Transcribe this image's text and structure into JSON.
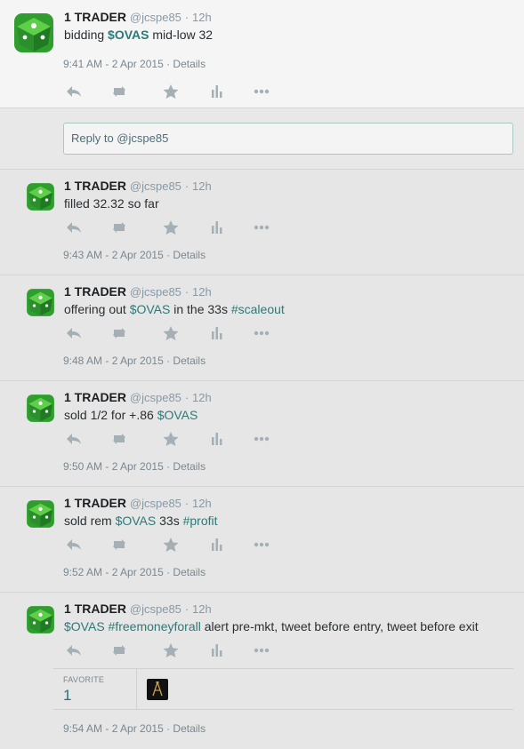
{
  "tweets": [
    {
      "name": "1 TRADER",
      "handle": "@jcspe85",
      "dot": "·",
      "age": "12h",
      "parts": [
        {
          "t": "bidding ",
          "k": "text"
        },
        {
          "t": "$OVAS",
          "k": "cash"
        },
        {
          "t": "  mid-low  32",
          "k": "text"
        }
      ],
      "stamp": "9:41 AM - 2 Apr 2015 · Details"
    },
    {
      "name": "1 TRADER",
      "handle": "@jcspe85",
      "dot": "·",
      "age": "12h",
      "parts": [
        {
          "t": "filled 32.32 so far",
          "k": "text"
        }
      ],
      "stamp": "9:43 AM - 2 Apr 2015 · Details"
    },
    {
      "name": "1 TRADER",
      "handle": "@jcspe85",
      "dot": "·",
      "age": "12h",
      "parts": [
        {
          "t": "offering out ",
          "k": "text"
        },
        {
          "t": "$OVAS",
          "k": "cash"
        },
        {
          "t": " in the 33s ",
          "k": "text"
        },
        {
          "t": "#scaleout",
          "k": "tag"
        }
      ],
      "stamp": "9:48 AM - 2 Apr 2015 · Details"
    },
    {
      "name": "1 TRADER",
      "handle": "@jcspe85",
      "dot": "·",
      "age": "12h",
      "parts": [
        {
          "t": "sold 1/2 for +.86 ",
          "k": "text"
        },
        {
          "t": "$OVAS",
          "k": "cash"
        }
      ],
      "stamp": "9:50 AM - 2 Apr 2015 · Details"
    },
    {
      "name": "1 TRADER",
      "handle": "@jcspe85",
      "dot": "·",
      "age": "12h",
      "parts": [
        {
          "t": "sold rem ",
          "k": "text"
        },
        {
          "t": "$OVAS",
          "k": "cash"
        },
        {
          "t": " 33s ",
          "k": "text"
        },
        {
          "t": "#profit",
          "k": "tag"
        }
      ],
      "stamp": "9:52 AM - 2 Apr 2015 · Details"
    },
    {
      "name": "1 TRADER",
      "handle": "@jcspe85",
      "dot": "·",
      "age": "12h",
      "parts": [
        {
          "t": "$OVAS",
          "k": "cash"
        },
        {
          "t": " ",
          "k": "text"
        },
        {
          "t": "#freemoneyforall",
          "k": "tag"
        },
        {
          "t": " alert pre-mkt, tweet before entry, tweet before exit",
          "k": "text"
        }
      ],
      "stamp": "9:54 AM - 2 Apr 2015 · Details"
    }
  ],
  "reply": {
    "placeholder": "Reply to @jcspe85"
  },
  "favorites": {
    "label": "FAVORITE",
    "count": "1"
  },
  "icons": [
    "reply-icon",
    "retweet-icon",
    "favorite-icon",
    "stats-icon",
    "more-icon"
  ],
  "colors": {
    "link": "#2b7a78",
    "muted": "#8899a6",
    "icon": "#a4afb6"
  }
}
